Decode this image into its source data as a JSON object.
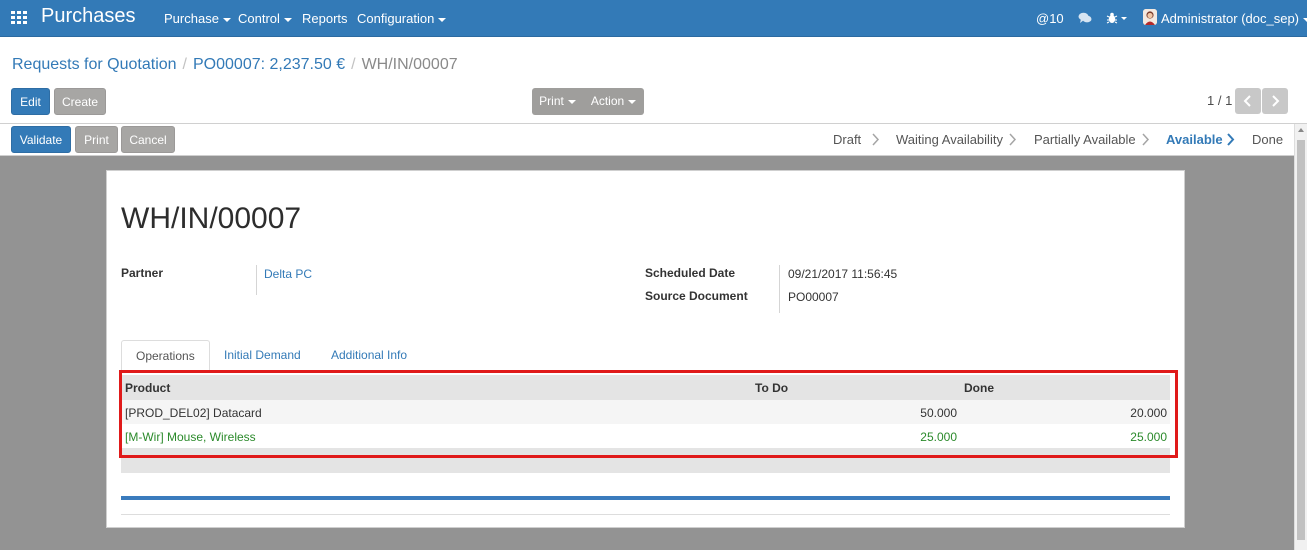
{
  "navbar": {
    "brand": "Purchases",
    "menus": [
      "Purchase",
      "Control",
      "Reports",
      "Configuration"
    ],
    "mentions": "@10",
    "user": "Administrator (doc_sep)"
  },
  "breadcrumb": {
    "items": [
      "Requests for Quotation",
      "PO00007: 2,237.50 €"
    ],
    "current": "WH/IN/00007"
  },
  "toolbar": {
    "edit": "Edit",
    "create": "Create",
    "print": "Print",
    "action": "Action",
    "pager": "1 / 1"
  },
  "statusbar": {
    "buttons": {
      "validate": "Validate",
      "print": "Print",
      "cancel": "Cancel"
    },
    "states": [
      "Draft",
      "Waiting Availability",
      "Partially Available",
      "Available",
      "Done"
    ],
    "active_state": "Available"
  },
  "form": {
    "title": "WH/IN/00007",
    "partner_label": "Partner",
    "partner_value": "Delta PC",
    "scheduled_label": "Scheduled Date",
    "scheduled_value": "09/21/2017 11:56:45",
    "source_label": "Source Document",
    "source_value": "PO00007",
    "tabs": [
      "Operations",
      "Initial Demand",
      "Additional Info"
    ],
    "operations": {
      "headers": [
        "Product",
        "To Do",
        "Done"
      ],
      "rows": [
        {
          "product": "[PROD_DEL02] Datacard",
          "todo": "50.000",
          "done": "20.000"
        },
        {
          "product": "[M-Wir] Mouse, Wireless",
          "todo": "25.000",
          "done": "25.000"
        }
      ]
    }
  },
  "colors": {
    "primary": "#337ab7",
    "highlight": "#e01a1a",
    "done_row": "#2b8a2b"
  }
}
